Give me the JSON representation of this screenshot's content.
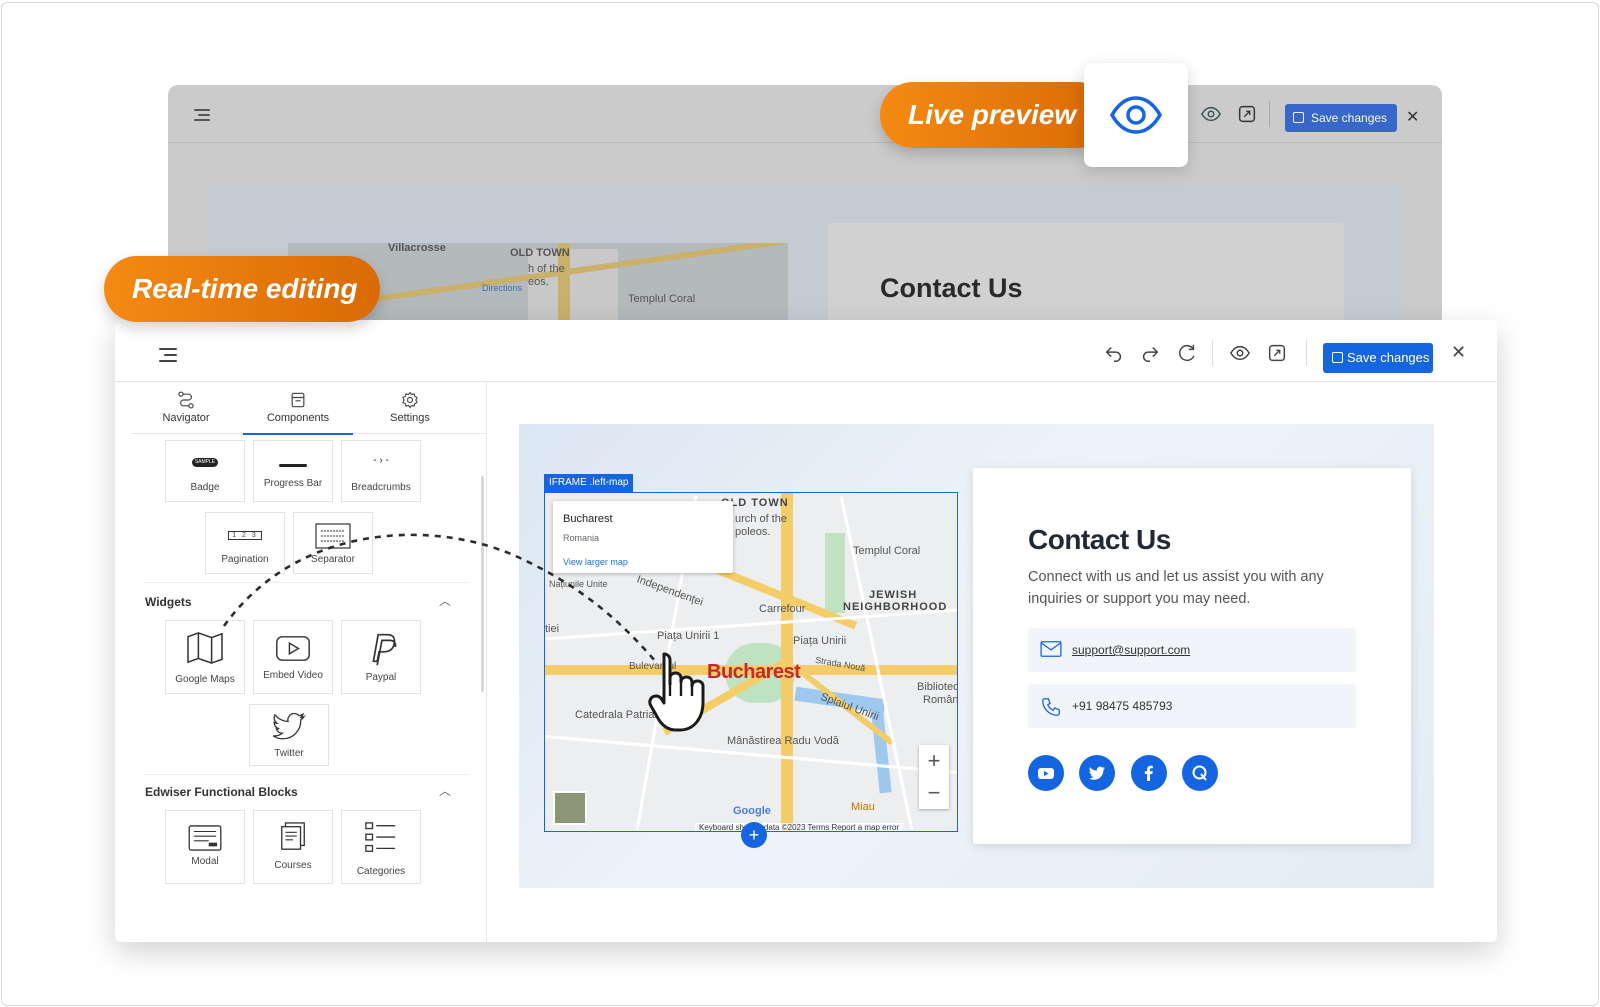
{
  "callouts": {
    "live_preview": "Live preview",
    "realtime_editing": "Real-time editing"
  },
  "back_window": {
    "save_label": "Save changes",
    "card_title": "Contact Us",
    "map_labels": {
      "villacrosse": "Villacrosse",
      "old_town": "OLD TOWN",
      "directions": "Directions",
      "templul": "Templul Coral",
      "of_the": "h of the",
      "eos": "eos."
    }
  },
  "toolbar": {
    "save_label": "Save changes",
    "icons": [
      "undo-icon",
      "redo-icon",
      "refresh-icon",
      "eye-icon",
      "expand-icon",
      "close-icon"
    ]
  },
  "sidebar": {
    "tabs": [
      {
        "label": "Navigator",
        "icon": "navigator-icon"
      },
      {
        "label": "Components",
        "icon": "components-icon",
        "active": true
      },
      {
        "label": "Settings",
        "icon": "settings-icon"
      }
    ],
    "basic_tiles": [
      {
        "label": "Badge",
        "icon": "badge-icon",
        "glyph": "SAMPLE"
      },
      {
        "label": "Progress Bar",
        "icon": "progress-bar-icon"
      },
      {
        "label": "Breadcrumbs",
        "icon": "breadcrumbs-icon",
        "glyph": "- › -"
      },
      {
        "label": "Pagination",
        "icon": "pagination-icon",
        "glyph": "1 2 3"
      },
      {
        "label": "Separator",
        "icon": "separator-icon"
      }
    ],
    "widgets": {
      "title": "Widgets",
      "tiles": [
        {
          "label": "Google Maps",
          "icon": "map-icon"
        },
        {
          "label": "Embed Video",
          "icon": "video-icon"
        },
        {
          "label": "Paypal",
          "icon": "paypal-icon"
        },
        {
          "label": "Twitter",
          "icon": "twitter-icon"
        }
      ]
    },
    "functional": {
      "title": "Edwiser Functional Blocks",
      "tiles": [
        {
          "label": "Modal",
          "icon": "modal-icon"
        },
        {
          "label": "Courses",
          "icon": "courses-icon"
        },
        {
          "label": "Categories",
          "icon": "categories-icon"
        }
      ]
    }
  },
  "map": {
    "tag": "IFRAME .left-map",
    "popup_title": "Bucharest",
    "popup_sub": "Romania",
    "popup_link": "View larger map",
    "city": "Bucharest",
    "labels": {
      "old_town": "OLD TOWN",
      "urch": "urch of the",
      "poleos": "poleos.",
      "templul": "Templul Coral",
      "jewish": "JEWISH",
      "neighborhood": "NEIGHBORHOOD",
      "carrefour": "Carrefour",
      "independentei": "Independenței",
      "natiunile": "Națiunile Unite",
      "piata_unirii_1": "Piața Unirii 1",
      "piata_unirii": "Piața Unirii",
      "strada_noua": "Strada Nouă",
      "bulevardul": "Bulevardul",
      "splaiul": "Splaiul Unirii",
      "biblioteca": "Bibliotec",
      "romana": "Român",
      "catedrala": "Catedrala Patriar",
      "manastirea": "Mânăstirea Radu Vodă",
      "miau": "Miau",
      "google": "Google",
      "tiei": "tiei"
    },
    "attribution": "Keyboard sh    Map data ©2023    Terms    Report a map error"
  },
  "contact": {
    "title": "Contact Us",
    "description": "Connect with us and let us assist you with any inquiries or support you may need.",
    "email": "support@support.com",
    "phone": "+91 98475 485793",
    "socials": [
      "youtube-icon",
      "twitter-icon",
      "facebook-icon",
      "quora-icon"
    ]
  },
  "colors": {
    "accent": "#1565e0",
    "callout": "#f07d0f",
    "city": "#c62828"
  }
}
